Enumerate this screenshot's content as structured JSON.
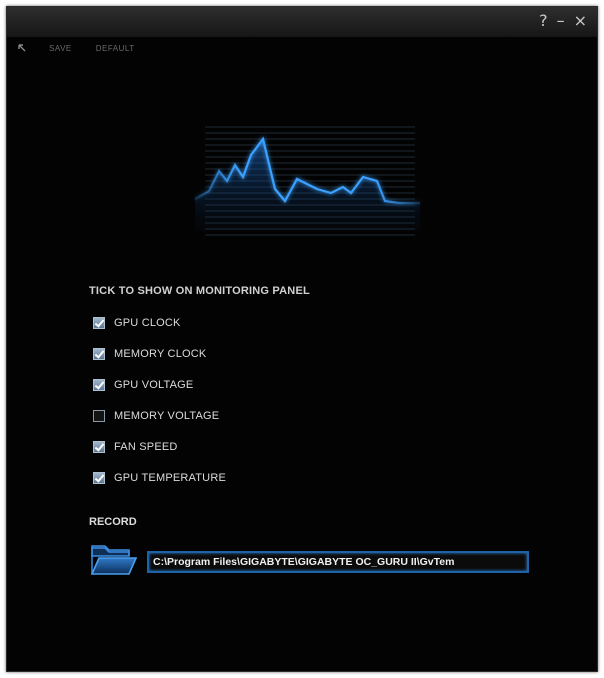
{
  "titlebar": {
    "help_glyph": "?",
    "minimize_glyph": "–",
    "close_glyph": "×"
  },
  "toolbar": {
    "save_label": "SAVE",
    "default_label": "DEFAULT"
  },
  "monitoring": {
    "title": "TICK TO SHOW ON MONITORING PANEL",
    "items": [
      {
        "label": "GPU CLOCK",
        "checked": true
      },
      {
        "label": "MEMORY CLOCK",
        "checked": true
      },
      {
        "label": "GPU VOLTAGE",
        "checked": true
      },
      {
        "label": "MEMORY VOLTAGE",
        "checked": false
      },
      {
        "label": "FAN SPEED",
        "checked": true
      },
      {
        "label": "GPU TEMPERATURE",
        "checked": true
      }
    ]
  },
  "record": {
    "label": "RECORD",
    "path": "C:\\Program Files\\GIGABYTE\\GIGABYTE OC_GURU II\\GvTem"
  },
  "colors": {
    "accent": "#1e63a8",
    "graph_line": "#3aa0ff",
    "background": "#030303"
  },
  "icons": {
    "back": "back-arrow-icon",
    "folder": "folder-icon",
    "graph": "monitor-graph-icon"
  }
}
